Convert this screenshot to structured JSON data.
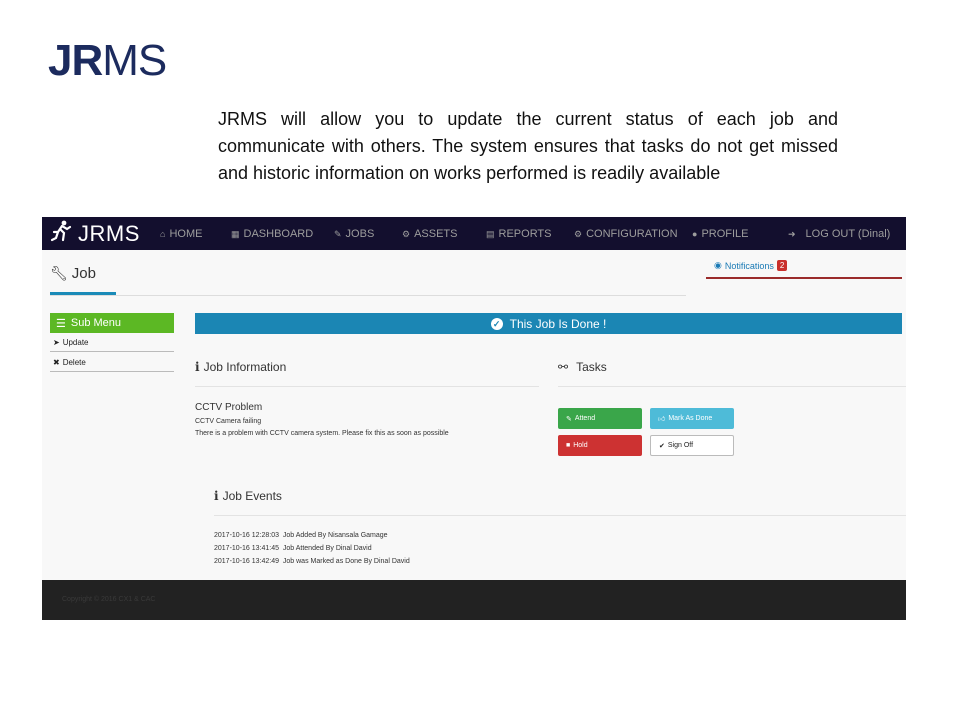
{
  "slide": {
    "title_bold": "JR",
    "title_light": "MS",
    "intro": "JRMS will allow you to update the current status of each job and communicate with others. The system ensures that tasks do not get missed and historic information on works performed is readily available"
  },
  "app": {
    "brand": "JRMS",
    "nav": [
      {
        "label": "HOME",
        "icon": "home-icon"
      },
      {
        "label": "DASHBOARD",
        "icon": "grid-icon"
      },
      {
        "label": "JOBS",
        "icon": "wrench-icon"
      },
      {
        "label": "ASSETS",
        "icon": "bike-icon"
      },
      {
        "label": "REPORTS",
        "icon": "print-icon"
      },
      {
        "label": "CONFIGURATION",
        "icon": "gears-icon"
      },
      {
        "label": "PROFILE",
        "icon": "user-icon"
      },
      {
        "label": "LOG OUT (Dinal)",
        "icon": "sign-out-icon"
      }
    ],
    "page_title": "Job",
    "notifications": {
      "label": "Notifications",
      "count": "2"
    },
    "submenu": {
      "title": "Sub Menu",
      "items": [
        {
          "label": "Update",
          "icon": "send-icon"
        },
        {
          "label": "Delete",
          "icon": "close-icon"
        }
      ]
    },
    "status_banner": "This Job Is Done !",
    "job_info": {
      "title": "Job Information",
      "job_title": "CCTV Problem",
      "job_subtitle": "CCTV Camera failing",
      "description": "There is a problem with CCTV camera system. Please fix this as soon as possible"
    },
    "tasks": {
      "title": "Tasks",
      "buttons": {
        "attend": "Attend",
        "mark_done": "Mark As Done",
        "hold": "Hold",
        "sign_off": "Sign Off"
      }
    },
    "job_events": {
      "title": "Job Events",
      "items": [
        {
          "time": "2017-10-16 12:28:03",
          "text": "Job Added By Nisansala Gamage"
        },
        {
          "time": "2017-10-16 13:41:45",
          "text": "Job Attended By Dinal David"
        },
        {
          "time": "2017-10-16 13:42:49",
          "text": "Job was Marked as Done By Dinal David"
        }
      ]
    },
    "footer": "Copyright © 2016 CX1 & CAC",
    "colors": {
      "navbar": "#130f2e",
      "submenu": "#5cb824",
      "banner": "#1b86b4",
      "attend": "#3aa64a",
      "mark_done": "#4ebbd8",
      "hold": "#cd3232",
      "title": "#1c2b5e"
    }
  }
}
